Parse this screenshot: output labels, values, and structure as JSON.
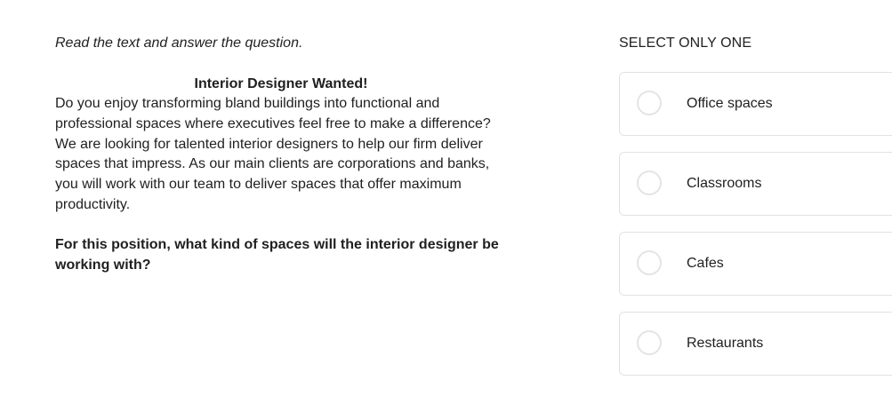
{
  "instruction": "Read the text and answer the question.",
  "passage": {
    "title": "Interior Designer Wanted!",
    "body": "Do you enjoy transforming bland buildings into functional and professional spaces where executives feel free to make a difference? We are looking for talented interior designers to help our firm deliver spaces that impress. As our main clients are corporations and banks, you will work with our team to deliver spaces that offer maximum productivity."
  },
  "question": "For this position, what kind of spaces will the interior designer be working with?",
  "answer_panel": {
    "select_label": "SELECT ONLY ONE",
    "options": [
      {
        "label": "Office spaces"
      },
      {
        "label": "Classrooms"
      },
      {
        "label": "Cafes"
      },
      {
        "label": "Restaurants"
      }
    ]
  }
}
